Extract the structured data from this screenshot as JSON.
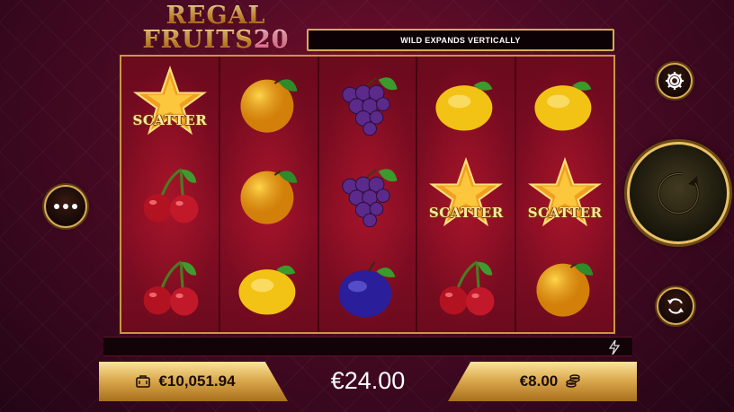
{
  "game": {
    "logo_line1": "REGAL",
    "logo_line2": "FRUITS",
    "logo_number": "20",
    "banner": "WILD EXPANDS VERTICALLY"
  },
  "reels": [
    [
      {
        "symbol": "star-scatter",
        "label": "SCATTER"
      },
      {
        "symbol": "cherry"
      },
      {
        "symbol": "cherry"
      }
    ],
    [
      {
        "symbol": "orange"
      },
      {
        "symbol": "orange"
      },
      {
        "symbol": "lemon"
      }
    ],
    [
      {
        "symbol": "grape"
      },
      {
        "symbol": "grape"
      },
      {
        "symbol": "plum"
      }
    ],
    [
      {
        "symbol": "lemon"
      },
      {
        "symbol": "star-scatter",
        "label": "SCATTER"
      },
      {
        "symbol": "cherry"
      }
    ],
    [
      {
        "symbol": "lemon"
      },
      {
        "symbol": "star-scatter",
        "label": "SCATTER"
      },
      {
        "symbol": "orange"
      }
    ]
  ],
  "balance": "€10,051.94",
  "win": "€24.00",
  "bet": "€8.00",
  "colors": {
    "gold": "#d9aa52",
    "reel_bg": "#8c0f26",
    "background": "#4a0a24"
  },
  "icons": {
    "menu": "more-dots-icon",
    "settings": "gear-icon",
    "spin": "spin-arrow-icon",
    "autoplay": "autoplay-icon",
    "turbo": "lightning-icon",
    "balance": "wallet-icon",
    "bet": "coins-icon"
  }
}
